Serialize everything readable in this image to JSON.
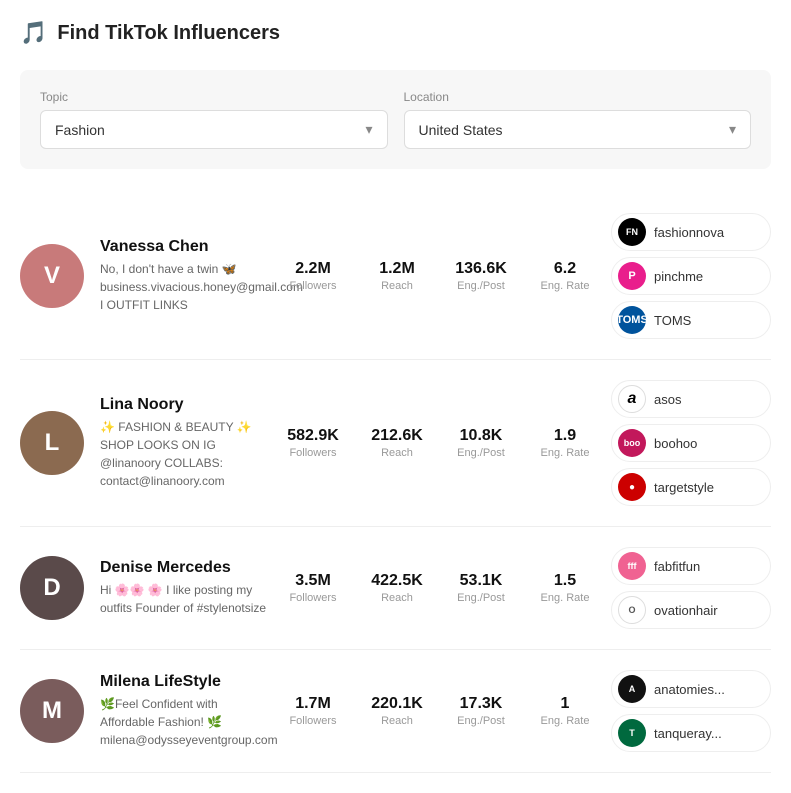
{
  "page": {
    "title": "Find TikTok Influencers",
    "icon": "🎵"
  },
  "filters": {
    "topic_label": "Topic",
    "topic_value": "Fashion",
    "location_label": "Location",
    "location_value": "United States"
  },
  "influencers": [
    {
      "id": 1,
      "name": "Vanessa Chen",
      "bio": "No, I don't have a twin 🦋 business.vivacious.honey@gmail.com I OUTFIT LINKS",
      "avatar_color": "#c87a7a",
      "avatar_initial": "V",
      "stats": {
        "followers": "2.2M",
        "reach": "1.2M",
        "eng_per_post": "136.6K",
        "eng_rate": "6.2"
      },
      "brands": [
        {
          "name": "fashionnova",
          "class": "brand-fashionnova",
          "text": "FN"
        },
        {
          "name": "pinchme",
          "class": "brand-pinchme",
          "text": "P"
        },
        {
          "name": "TOMS",
          "class": "brand-toms",
          "text": "TOMS"
        }
      ]
    },
    {
      "id": 2,
      "name": "Lina Noory",
      "bio": "✨ FASHION & BEAUTY ✨ SHOP LOOKS ON IG @linanoory COLLABS: contact@linanoory.com",
      "avatar_color": "#8b6a50",
      "avatar_initial": "L",
      "stats": {
        "followers": "582.9K",
        "reach": "212.6K",
        "eng_per_post": "10.8K",
        "eng_rate": "1.9"
      },
      "brands": [
        {
          "name": "asos",
          "class": "brand-asos",
          "text": "a"
        },
        {
          "name": "boohoo",
          "class": "brand-boohoo",
          "text": "boo"
        },
        {
          "name": "targetstyle",
          "class": "brand-targetstyle",
          "text": "●"
        }
      ]
    },
    {
      "id": 3,
      "name": "Denise Mercedes",
      "bio": "Hi 🌸🌸 🌸 I like posting my outfits Founder of #stylenotsize",
      "avatar_color": "#5a4a4a",
      "avatar_initial": "D",
      "stats": {
        "followers": "3.5M",
        "reach": "422.5K",
        "eng_per_post": "53.1K",
        "eng_rate": "1.5"
      },
      "brands": [
        {
          "name": "fabfitfun",
          "class": "brand-fabfitfun",
          "text": "fff"
        },
        {
          "name": "ovationhair",
          "class": "brand-ovationhair",
          "text": "O"
        }
      ]
    },
    {
      "id": 4,
      "name": "Milena LifeStyle",
      "bio": "🌿Feel Confident with Affordable Fashion! 🌿 milena@odysseyeventgroup.com",
      "avatar_color": "#7a5c5c",
      "avatar_initial": "M",
      "stats": {
        "followers": "1.7M",
        "reach": "220.1K",
        "eng_per_post": "17.3K",
        "eng_rate": "1"
      },
      "brands": [
        {
          "name": "anatomies...",
          "class": "brand-anatomies",
          "text": "A"
        },
        {
          "name": "tanqueray...",
          "class": "brand-tanqueray",
          "text": "T"
        }
      ]
    }
  ],
  "stat_labels": {
    "followers": "Followers",
    "reach": "Reach",
    "eng_per_post": "Eng./Post",
    "eng_rate": "Eng. Rate"
  }
}
